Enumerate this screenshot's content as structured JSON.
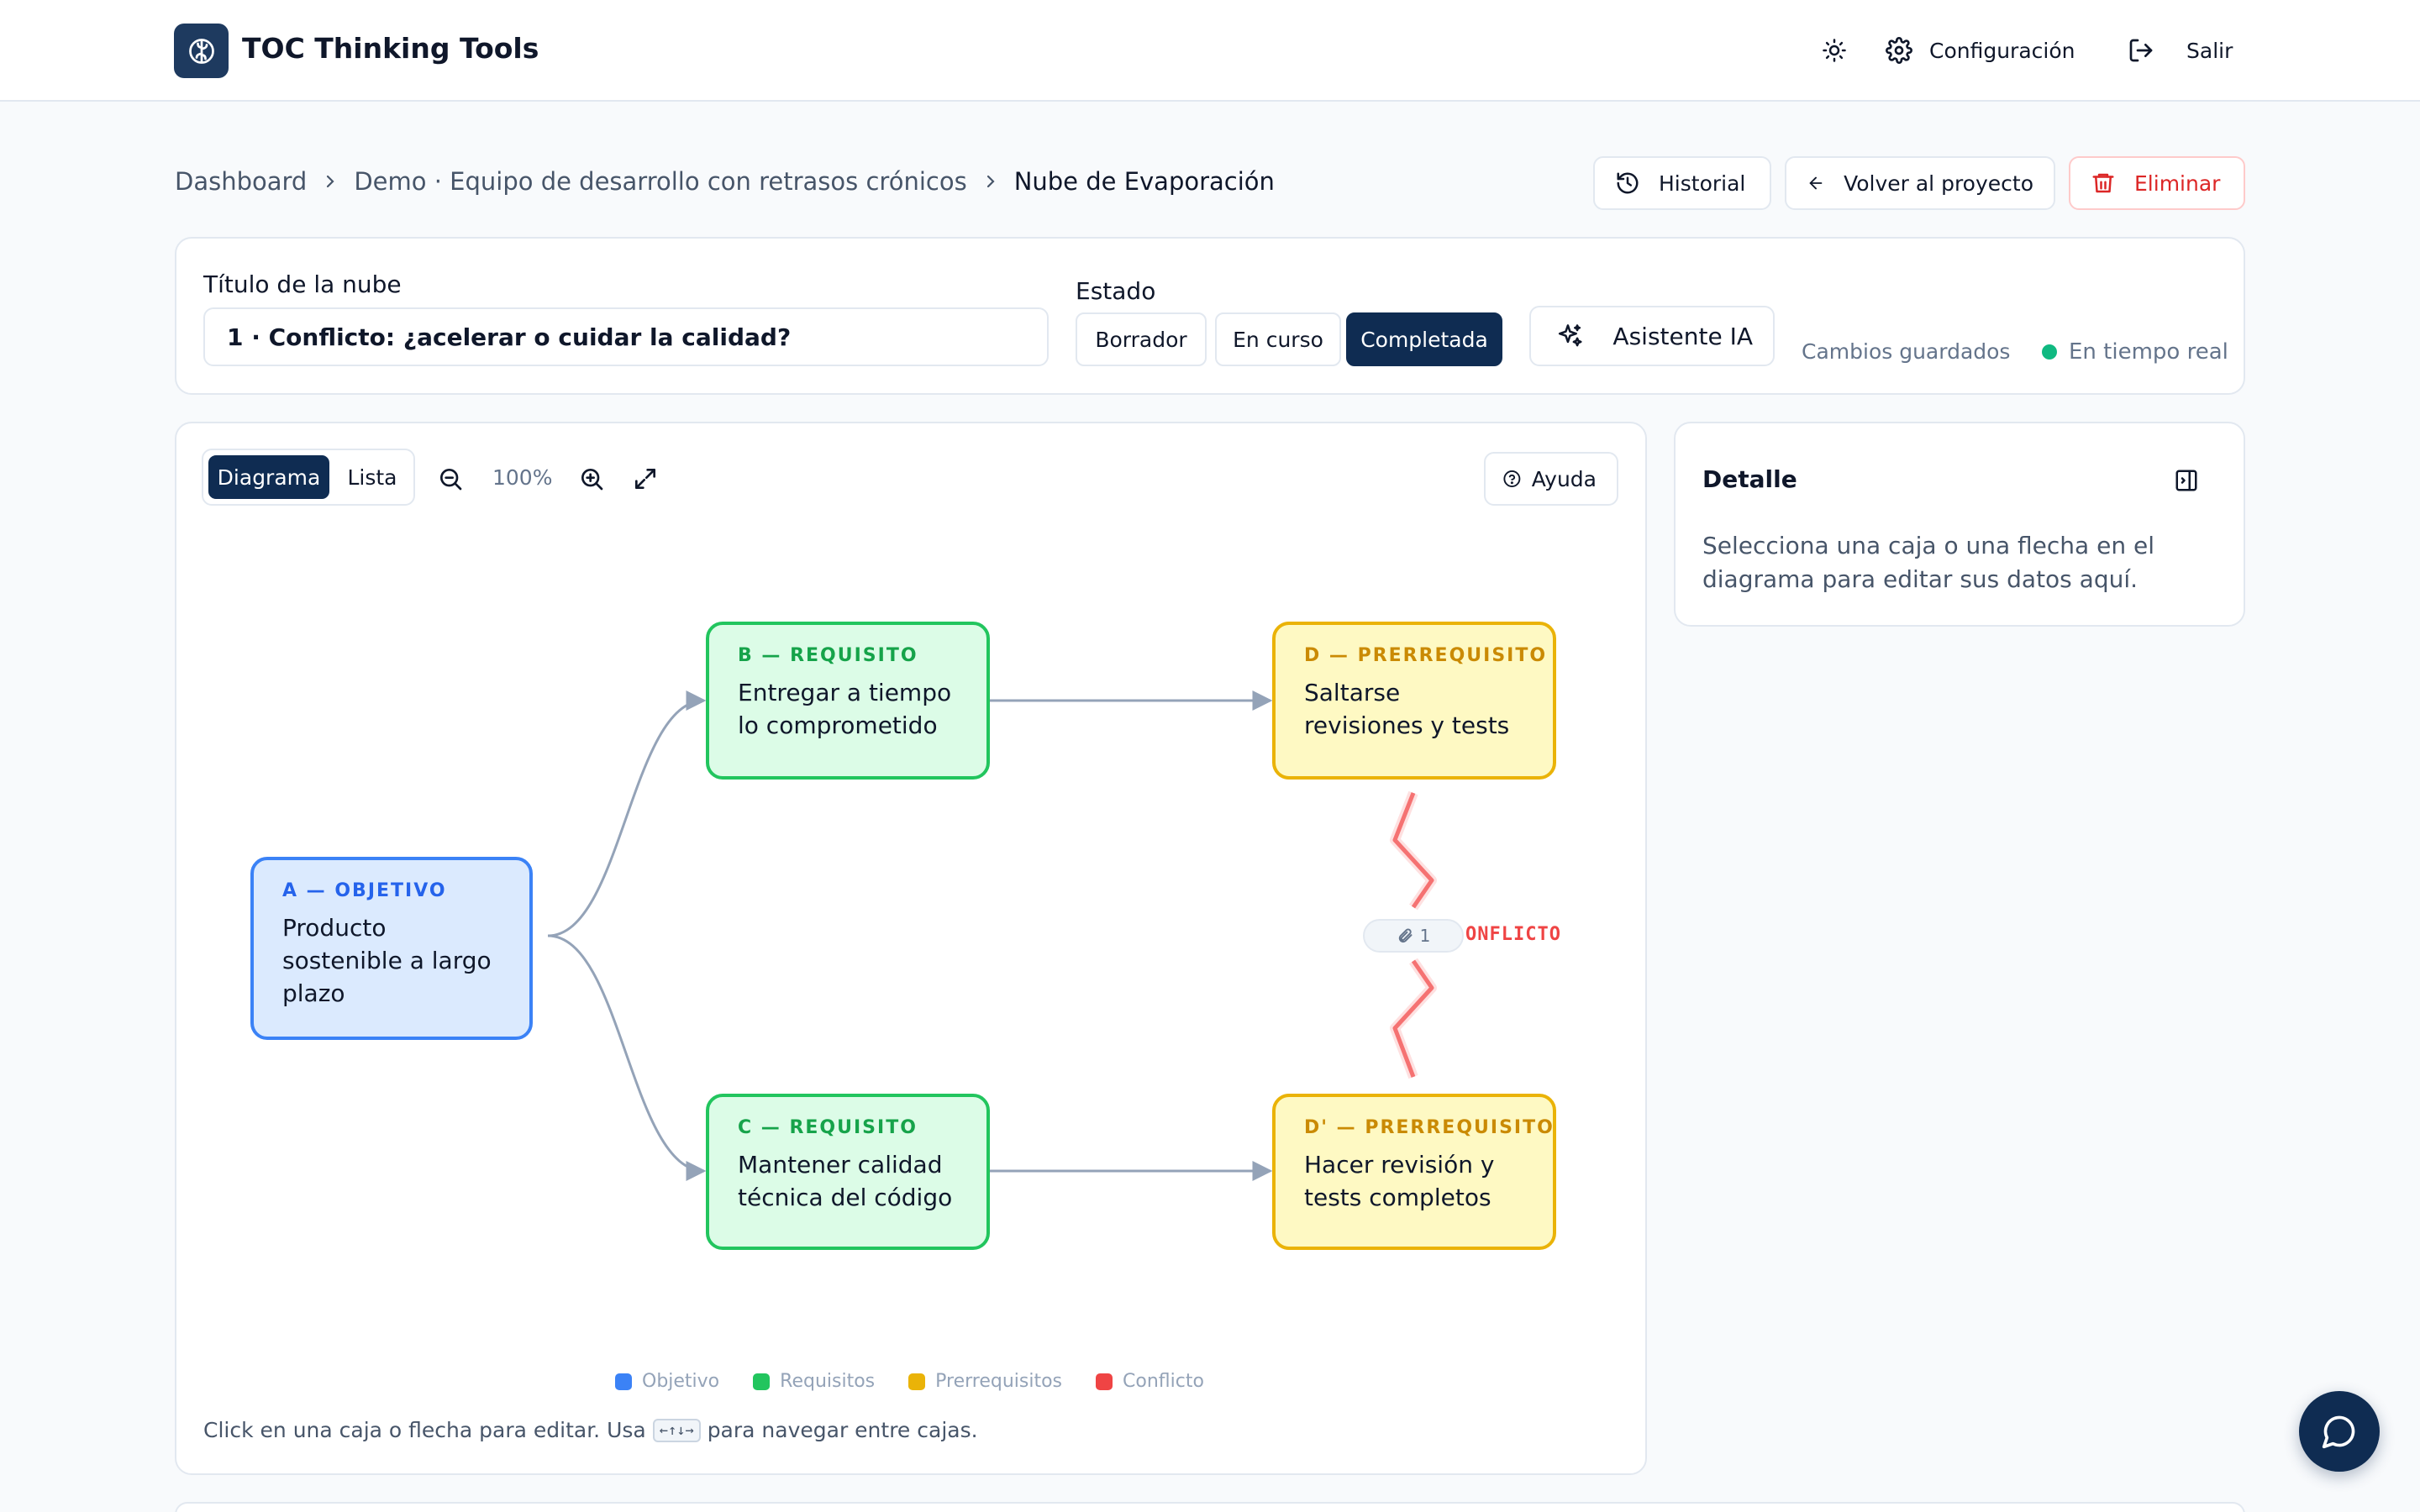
{
  "app": {
    "title": "TOC Thinking Tools"
  },
  "header": {
    "settings_label": "Configuración",
    "logout_label": "Salir"
  },
  "breadcrumb": [
    "Dashboard",
    "Demo · Equipo de desarrollo con retrasos crónicos",
    "Nube de Evaporación"
  ],
  "actions": {
    "history": "Historial",
    "back": "Volver al proyecto",
    "delete": "Eliminar"
  },
  "form": {
    "title_label": "Título de la nube",
    "title_value": "1 · Conflicto: ¿acelerar o cuidar la calidad?",
    "status_label": "Estado",
    "status_options": [
      "Borrador",
      "En curso",
      "Completada"
    ],
    "status_selected": "Completada",
    "ai_button": "Asistente IA",
    "saved_text": "Cambios guardados",
    "realtime_text": "En tiempo real"
  },
  "diagram": {
    "view_tabs": [
      "Diagrama",
      "Lista"
    ],
    "active_view": "Diagrama",
    "zoom": "100%",
    "help": "Ayuda",
    "nodes": {
      "a": {
        "tag": "A — OBJETIVO",
        "text": "Producto sostenible a largo plazo"
      },
      "b": {
        "tag": "B — REQUISITO",
        "text": "Entregar a tiempo lo comprometido"
      },
      "c": {
        "tag": "C — REQUISITO",
        "text": "Mantener calidad técnica del código"
      },
      "d": {
        "tag": "D — PRERREQUISITO",
        "text": "Saltarse revisiones y tests"
      },
      "dp": {
        "tag": "D' — PRERREQUISITO",
        "text": "Hacer revisión y tests completos"
      }
    },
    "conflict_label": "ONFLICTO",
    "attachment_count": "1",
    "legend": [
      "Objetivo",
      "Requisitos",
      "Prerrequisitos",
      "Conflicto"
    ],
    "hint_before": "Click en una caja o flecha para editar. Usa",
    "hint_keys": "←↑↓→",
    "hint_after": "para navegar entre cajas."
  },
  "detail": {
    "title": "Detalle",
    "placeholder": "Selecciona una caja o una flecha en el diagrama para editar sus datos aquí."
  },
  "colors": {
    "primary": "#0f2c52",
    "objective": "#3b82f6",
    "requirement": "#22c55e",
    "prerequisite": "#eab308",
    "conflict": "#ef4444"
  }
}
